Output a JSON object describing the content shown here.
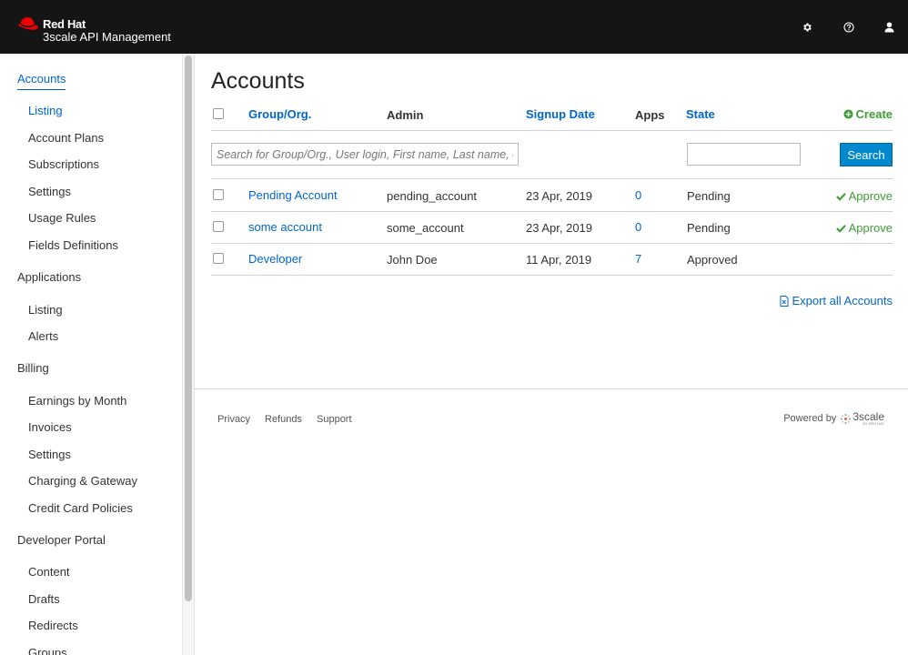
{
  "brand": {
    "name": "Red Hat",
    "product": "3scale API Management"
  },
  "header_icons": [
    "gear-icon",
    "help-icon",
    "user-icon"
  ],
  "sidebar": {
    "sections": [
      {
        "label": "Accounts",
        "items": [
          "Listing",
          "Account Plans",
          "Subscriptions",
          "Settings",
          "Usage Rules",
          "Fields Definitions"
        ]
      },
      {
        "label": "Applications",
        "items": [
          "Listing",
          "Alerts"
        ]
      },
      {
        "label": "Billing",
        "items": [
          "Earnings by Month",
          "Invoices",
          "Settings",
          "Charging & Gateway",
          "Credit Card Policies"
        ]
      },
      {
        "label": "Developer Portal",
        "items": [
          "Content",
          "Drafts",
          "Redirects",
          "Groups"
        ]
      }
    ]
  },
  "page": {
    "title": "Accounts",
    "create_label": "Create",
    "columns": {
      "group": "Group/Org.",
      "admin": "Admin",
      "signup": "Signup Date",
      "apps": "Apps",
      "state": "State"
    },
    "search_placeholder": "Search for Group/Org., User login, First name, Last name, e",
    "search_button": "Search",
    "approve_label": "Approve",
    "rows": [
      {
        "group": "Pending Account",
        "admin": "pending_account",
        "signup": "23 Apr, 2019",
        "apps": "0",
        "state": "Pending",
        "approve": true
      },
      {
        "group": "some account",
        "admin": "some_account",
        "signup": "23 Apr, 2019",
        "apps": "0",
        "state": "Pending",
        "approve": true
      },
      {
        "group": "Developer",
        "admin": "John Doe",
        "signup": "11 Apr, 2019",
        "apps": "7",
        "state": "Approved",
        "approve": false
      }
    ],
    "export_label": "Export all Accounts"
  },
  "footer": {
    "links": [
      "Privacy",
      "Refunds",
      "Support"
    ],
    "powered_by": "Powered by",
    "logo_text": "3scale",
    "logo_sub": "BY RED HAT"
  },
  "colors": {
    "topbar": "#151515",
    "link": "#0066cc",
    "success": "#3f9c35",
    "primary_button": "#0088ce",
    "brand_red": "#ee0000"
  }
}
